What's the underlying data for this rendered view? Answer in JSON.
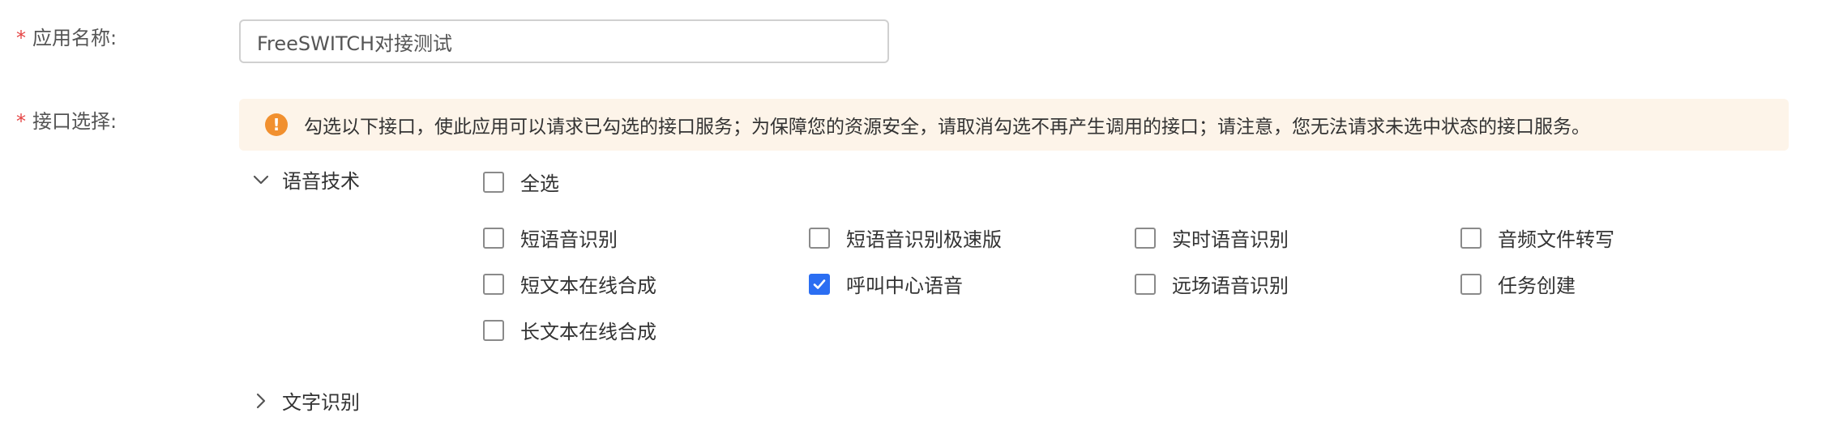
{
  "app_name": {
    "required_mark": "*",
    "label": "应用名称:",
    "value": "FreeSWITCH对接测试"
  },
  "api_select": {
    "required_mark": "*",
    "label": "接口选择:",
    "notice_icon": "!",
    "notice": "勾选以下接口，使此应用可以请求已勾选的接口服务；为保障您的资源安全，请取消勾选不再产生调用的接口；请注意，您无法请求未选中状态的接口服务。"
  },
  "groups": [
    {
      "name": "语音技术",
      "expanded": true,
      "icon": "chevron-down-icon",
      "select_all": {
        "label": "全选",
        "checked": false
      },
      "items": [
        {
          "label": "短语音识别",
          "checked": false
        },
        {
          "label": "短语音识别极速版",
          "checked": false
        },
        {
          "label": "实时语音识别",
          "checked": false
        },
        {
          "label": "音频文件转写",
          "checked": false
        },
        {
          "label": "短文本在线合成",
          "checked": false
        },
        {
          "label": "呼叫中心语音",
          "checked": true
        },
        {
          "label": "远场语音识别",
          "checked": false
        },
        {
          "label": "任务创建",
          "checked": false
        },
        {
          "label": "长文本在线合成",
          "checked": false
        }
      ]
    },
    {
      "name": "文字识别",
      "expanded": false,
      "icon": "chevron-right-icon"
    }
  ],
  "colors": {
    "required": "#e54545",
    "notice_bg": "#fdf4e9",
    "notice_icon": "#f1902f",
    "checkbox_checked": "#2b6ef2"
  }
}
